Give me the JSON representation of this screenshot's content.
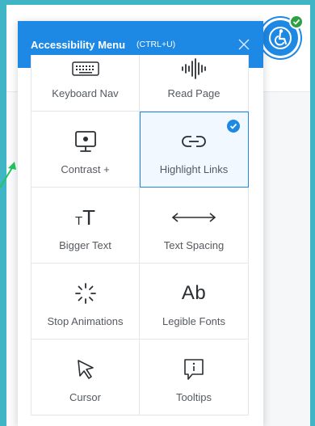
{
  "panel": {
    "title": "Accessibility Menu",
    "shortcut": "(CTRL+U)"
  },
  "tiles": [
    {
      "label": "Keyboard Nav",
      "icon": "keyboard-icon",
      "active": false
    },
    {
      "label": "Read Page",
      "icon": "soundwave-icon",
      "active": false
    },
    {
      "label": "Contrast +",
      "icon": "monitor-icon",
      "active": false
    },
    {
      "label": "Highlight Links",
      "icon": "link-icon",
      "active": true
    },
    {
      "label": "Bigger Text",
      "icon": "text-size-icon",
      "glyph": "T",
      "active": false
    },
    {
      "label": "Text Spacing",
      "icon": "horizontal-arrows-icon",
      "active": false
    },
    {
      "label": "Stop Animations",
      "icon": "loading-spinner-icon",
      "active": false
    },
    {
      "label": "Legible Fonts",
      "icon": "font-icon",
      "glyph": "Ab",
      "active": false
    },
    {
      "label": "Cursor",
      "icon": "cursor-icon",
      "active": false
    },
    {
      "label": "Tooltips",
      "icon": "tooltip-icon",
      "active": false
    }
  ],
  "colors": {
    "accent": "#1e88e5",
    "frame": "#3fb5c6",
    "success": "#2ea043"
  }
}
